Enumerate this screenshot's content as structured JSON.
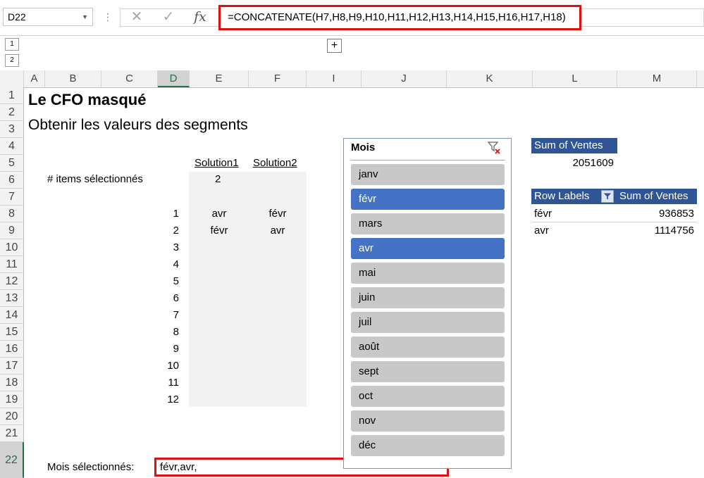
{
  "formula_bar": {
    "name_box": "D22",
    "formula": "=CONCATENATE(H7,H8,H9,H10,H11,H12,H13,H14,H15,H16,H17,H18)",
    "icons": [
      "cancel-icon",
      "enter-check-icon",
      "insert-function-icon"
    ],
    "fx_label": "fx",
    "cancel_glyph": "✕",
    "check_glyph": "✓"
  },
  "outline": {
    "levels": [
      "1",
      "2"
    ],
    "expand_label": "+"
  },
  "columns": [
    "A",
    "B",
    "C",
    "D",
    "E",
    "F",
    "I",
    "J",
    "K",
    "L",
    "M"
  ],
  "selected_column": "D",
  "rows": [
    "1",
    "2",
    "3",
    "4",
    "5",
    "6",
    "7",
    "8",
    "9",
    "10",
    "11",
    "12",
    "13",
    "14",
    "15",
    "16",
    "17",
    "18",
    "19",
    "20",
    "21",
    "22"
  ],
  "selected_row": "22",
  "sheet": {
    "title": "Le CFO masqué",
    "subtitle": "Obtenir les valeurs des segments",
    "header_solution1": "Solution1",
    "header_solution2": "Solution2",
    "items_label": "# items sélectionnés",
    "items_count": "2",
    "index_numbers": [
      "1",
      "2",
      "3",
      "4",
      "5",
      "6",
      "7",
      "8",
      "9",
      "10",
      "11",
      "12"
    ],
    "solution1": [
      "avr",
      "févr"
    ],
    "solution2": [
      "févr",
      "avr"
    ],
    "selected_months_label": "Mois sélectionnés:",
    "selected_months_value": "févr,avr,"
  },
  "slicer": {
    "title": "Mois",
    "clear_filter_icon": "clear-filter-icon",
    "items": [
      {
        "label": "janv",
        "selected": false
      },
      {
        "label": "févr",
        "selected": true
      },
      {
        "label": "mars",
        "selected": false
      },
      {
        "label": "avr",
        "selected": true
      },
      {
        "label": "mai",
        "selected": false
      },
      {
        "label": "juin",
        "selected": false
      },
      {
        "label": "juil",
        "selected": false
      },
      {
        "label": "août",
        "selected": false
      },
      {
        "label": "sept",
        "selected": false
      },
      {
        "label": "oct",
        "selected": false
      },
      {
        "label": "nov",
        "selected": false
      },
      {
        "label": "déc",
        "selected": false
      }
    ],
    "selected_color": "#4472c4",
    "unselected_color": "#c8c8c8"
  },
  "pivot1": {
    "header": "Sum of Ventes",
    "value": "2051609"
  },
  "pivot2": {
    "row_labels_header": "Row Labels",
    "sum_header": "Sum of Ventes",
    "rows": [
      {
        "label": "févr",
        "value": "936853"
      },
      {
        "label": "avr",
        "value": "1114756"
      }
    ],
    "header_color": "#2f5597"
  }
}
